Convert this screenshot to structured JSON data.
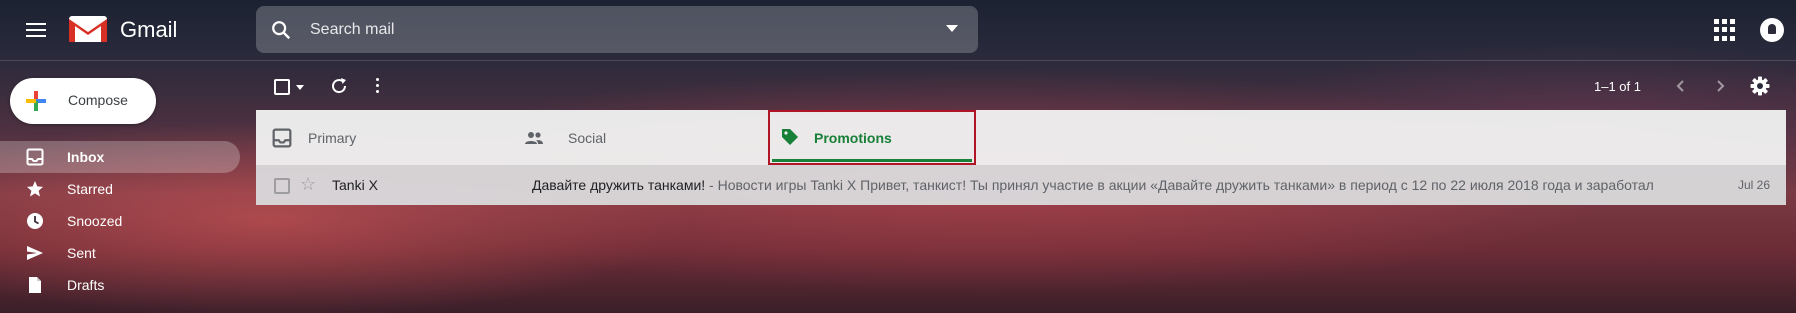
{
  "header": {
    "brand": "Gmail",
    "search_placeholder": "Search mail"
  },
  "sidebar": {
    "compose_label": "Compose",
    "items": [
      {
        "label": "Inbox",
        "icon": "inbox-icon",
        "active": true
      },
      {
        "label": "Starred",
        "icon": "star-icon"
      },
      {
        "label": "Snoozed",
        "icon": "clock-icon"
      },
      {
        "label": "Sent",
        "icon": "send-icon"
      },
      {
        "label": "Drafts",
        "icon": "draft-icon"
      }
    ]
  },
  "toolbar": {
    "pagination": "1–1 of 1"
  },
  "tabs": [
    {
      "label": "Primary",
      "icon": "inbox-icon"
    },
    {
      "label": "Social",
      "icon": "people-icon"
    },
    {
      "label": "Promotions",
      "icon": "tag-icon",
      "selected": true
    }
  ],
  "emails": [
    {
      "sender": "Tanki X",
      "subject": "Давайте дружить танками!",
      "snippet": " - Новости игры Tanki X Привет, танкист! Ты принял участие в акции «Давайте дружить танками» в период с 12 по 22 июля 2018 года и заработал",
      "date": "Jul 26"
    }
  ],
  "colors": {
    "promotions_accent": "#188038",
    "highlight_border": "#b01526"
  }
}
